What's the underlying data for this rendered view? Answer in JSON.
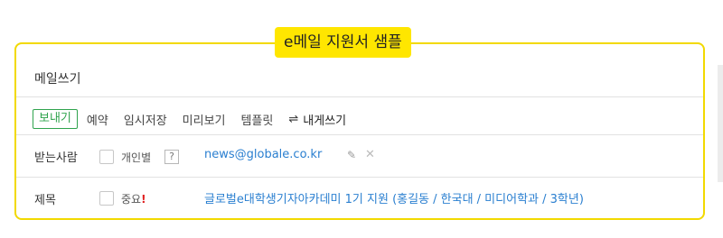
{
  "header": {
    "title": "e메일 지원서 샘플"
  },
  "mail": {
    "title": "메일쓰기"
  },
  "toolbar": {
    "send_label": "보내기",
    "reserve_label": "예약",
    "draft_label": "임시저장",
    "preview_label": "미리보기",
    "template_label": "템플릿",
    "to_self_label": "내게쓰기",
    "to_self_icon": "swap-icon"
  },
  "recipient": {
    "label": "받는사람",
    "individual_label": "개인별",
    "help_label": "?",
    "value": "news@globale.co.kr",
    "edit_icon": "pencil-icon",
    "remove_icon": "close-icon"
  },
  "subject": {
    "label": "제목",
    "important_label": "중요",
    "important_mark": "!",
    "value": "글로벌e대학생기자아카데미 1기 지원 (홍길동 / 한국대 / 미디어학과 / 3학년)"
  },
  "colors": {
    "accent": "#ffe600",
    "frame": "#f2d900",
    "send_button": "#2fa34d",
    "link": "#2a7fd0",
    "required": "#e02020"
  }
}
